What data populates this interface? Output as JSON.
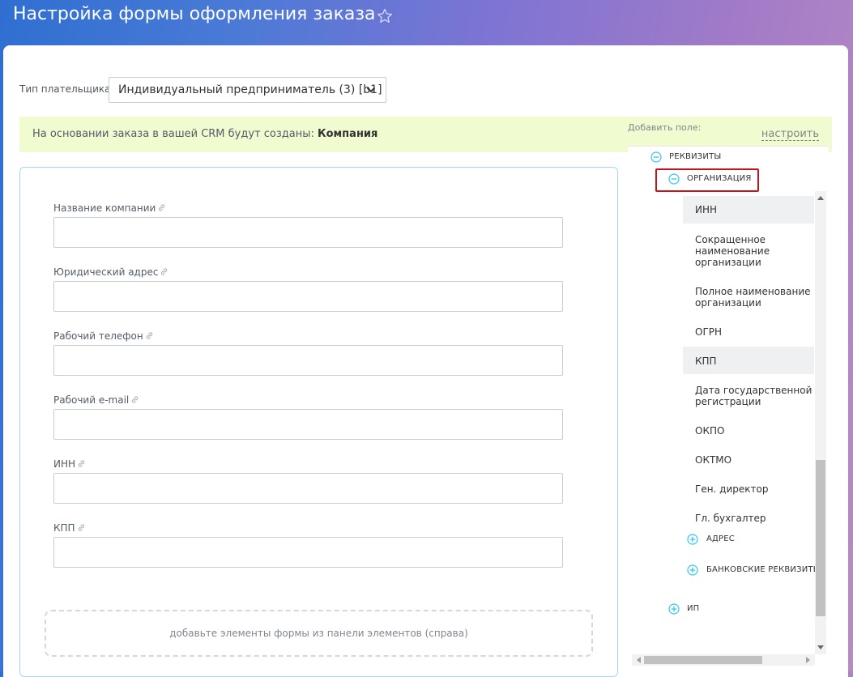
{
  "header": {
    "title": "Настройка формы оформления заказа"
  },
  "payer": {
    "label": "Тип плательщика:",
    "selected": "Индивидуальный предприниматель (3) [b1]"
  },
  "banner": {
    "text": "На основании заказа в вашей CRM будут созданы: ",
    "entity": "Компания",
    "link": "настроить"
  },
  "form": {
    "fields": [
      {
        "label": "Название компании",
        "value": ""
      },
      {
        "label": "Юридический адрес",
        "value": ""
      },
      {
        "label": "Рабочий телефон",
        "value": ""
      },
      {
        "label": "Рабочий e-mail",
        "value": ""
      },
      {
        "label": "ИНН",
        "value": ""
      },
      {
        "label": "КПП",
        "value": ""
      }
    ],
    "drop_zone": "добавьте элементы формы из панели элементов (справа)"
  },
  "sidebar": {
    "title": "Добавить поле:",
    "groups": {
      "requisites": "РЕКВИЗИТЫ",
      "organization": "ОРГАНИЗАЦИЯ",
      "address": "АДРЕС",
      "bank": "БАНКОВСКИЕ РЕКВИЗИТЫ",
      "ip": "ИП"
    },
    "items": [
      {
        "label": "ИНН",
        "active": true
      },
      {
        "label": "Сокращенное наименование организации",
        "active": false
      },
      {
        "label": "Полное наименование организации",
        "active": false
      },
      {
        "label": "ОГРН",
        "active": false
      },
      {
        "label": "КПП",
        "active": true
      },
      {
        "label": "Дата государственной регистрации",
        "active": false
      },
      {
        "label": "ОКПО",
        "active": false
      },
      {
        "label": "ОКТМО",
        "active": false
      },
      {
        "label": "Ген. директор",
        "active": false
      },
      {
        "label": "Гл. бухгалтер",
        "active": false
      }
    ]
  },
  "colors": {
    "accent": "#2fc6f6",
    "highlight": "#c4151c",
    "banner_bg": "#f1fbd0"
  }
}
